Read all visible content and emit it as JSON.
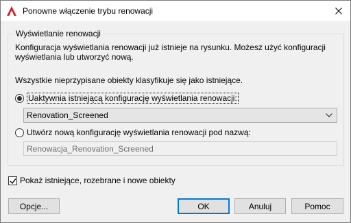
{
  "window": {
    "title": "Ponowne włączenie trybu renowacji",
    "icon": "autocad-a-icon",
    "close_icon": "close-icon"
  },
  "group": {
    "label": "Wyświetlanie renowacji",
    "description": "Konfiguracja wyświetlania renowacji już istnieje na rysunku. Możesz użyć konfiguracji wyświetlania lub utworzyć nową.",
    "unassigned_note": "Wszystkie nieprzypisane obiekty klasyfikuje się jako istniejące."
  },
  "option_existing": {
    "label": "Uaktywnia istniejącą konfigurację wyświetlania renowacji:",
    "selected": true
  },
  "config_select": {
    "value": "Renovation_Screened"
  },
  "option_new": {
    "label": "Utwórz nową konfigurację wyświetlania renowacji pod nazwą:",
    "selected": false
  },
  "new_name_field": {
    "value": "Renowacja_Renovation_Screened"
  },
  "show_checkbox": {
    "label": "Pokaż istniejące, rozebrane i nowe obiekty",
    "checked": true
  },
  "buttons": {
    "options": "Opcje...",
    "ok": "OK",
    "cancel": "Anuluj",
    "help": "Pomoc"
  },
  "colors": {
    "accent": "#0078d7",
    "logo_red": "#d8232a"
  }
}
